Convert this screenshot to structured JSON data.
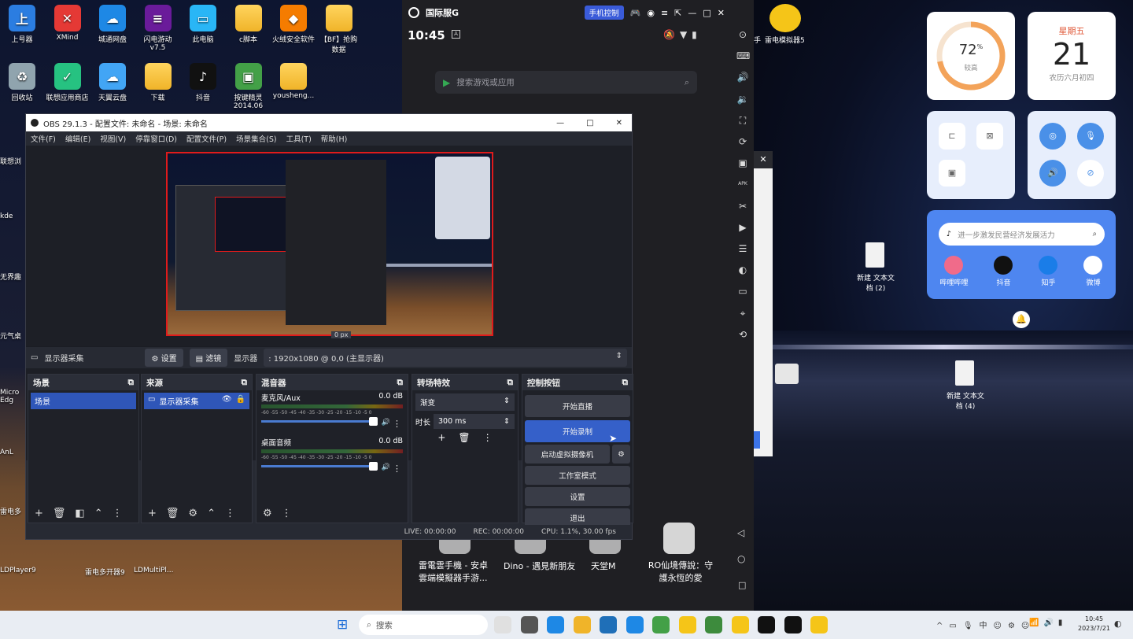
{
  "desktop_left_icons": [
    {
      "label": "上号器",
      "color": "#2b7de1",
      "glyph": "上"
    },
    {
      "label": "XMind",
      "color": "#e53935",
      "glyph": "✕"
    },
    {
      "label": "城通网盘",
      "color": "#1e88e5",
      "glyph": "☁"
    },
    {
      "label": "闪电游动\nv7.5",
      "color": "#6a1b9a",
      "glyph": "≡"
    },
    {
      "label": "此电脑",
      "color": "#29b6f6",
      "glyph": "▭"
    },
    {
      "label": "c脚本",
      "color": "folder",
      "glyph": ""
    },
    {
      "label": "火绒安全软件",
      "color": "#f57c00",
      "glyph": "◆"
    },
    {
      "label": "【BF】抢购\n数据",
      "color": "folder",
      "glyph": ""
    }
  ],
  "desktop_left_icons_row2": [
    {
      "label": "回收站",
      "color": "#90a4ae",
      "glyph": "♻"
    },
    {
      "label": "联想应用商店",
      "color": "#26c281",
      "glyph": "✓"
    },
    {
      "label": "天翼云盘",
      "color": "#42a5f5",
      "glyph": "☁"
    },
    {
      "label": "下载",
      "color": "folder",
      "glyph": ""
    },
    {
      "label": "抖音",
      "color": "#111",
      "glyph": "♪"
    },
    {
      "label": "按键精灵\n2014.06",
      "color": "#43a047",
      "glyph": "▣"
    },
    {
      "label": "yousheng...",
      "color": "folder",
      "glyph": ""
    }
  ],
  "desktop_side_labels": [
    "联想浏",
    "kde",
    "无界趣",
    "元气桌",
    "Micro\nEdg",
    "AnL",
    "雷电多",
    "LDPlayer9",
    "雷电多开器9",
    "LDMultiPl..."
  ],
  "android": {
    "brand": "国际服G",
    "control_badge": "手机控制",
    "time": "10:45",
    "search_placeholder": "搜索游戏或应用",
    "apps": [
      {
        "label": "雷電雲手機 - 安卓\n雲端模擬器手游..."
      },
      {
        "label": "Dino - 遇見新朋友"
      },
      {
        "label": "天堂M"
      },
      {
        "label": "RO仙境傳說：守\n護永恆的愛"
      }
    ]
  },
  "obs": {
    "title": "OBS 29.1.3 - 配置文件: 未命名 - 场景: 未命名",
    "menu": [
      "文件(F)",
      "编辑(E)",
      "视图(V)",
      "停靠窗口(D)",
      "配置文件(P)",
      "场景集合(S)",
      "工具(T)",
      "帮助(H)"
    ],
    "px_label": "0 px",
    "source_name": "显示器采集",
    "settings_btn": "设置",
    "filter_btn": "滤镜",
    "display_label": "显示器",
    "display_value": ": 1920x1080 @ 0,0 (主显示器)",
    "docks": {
      "scenes": {
        "title": "场景",
        "items": [
          "场景"
        ]
      },
      "sources": {
        "title": "来源",
        "items": [
          "显示器采集"
        ]
      },
      "mixer": {
        "title": "混音器",
        "tracks": [
          {
            "name": "麦克风/Aux",
            "db": "0.0 dB"
          },
          {
            "name": "桌面音频",
            "db": "0.0 dB"
          }
        ],
        "scale": "-60 -55 -50 -45 -40 -35 -30 -25 -20 -15 -10 -5 0"
      },
      "transitions": {
        "title": "转场特效",
        "type": "渐变",
        "duration_label": "时长",
        "duration": "300 ms"
      },
      "controls": {
        "title": "控制按钮",
        "buttons": [
          "开始直播",
          "开始录制",
          "启动虚拟摄像机",
          "工作室模式",
          "设置",
          "退出"
        ]
      }
    },
    "status": {
      "live": "LIVE: 00:00:00",
      "rec": "REC: 00:00:00",
      "cpu": "CPU: 1.1%, 30.00 fps"
    }
  },
  "widgets": {
    "battery_pct": "72",
    "battery_unit": "%",
    "battery_label": "较高",
    "weekday": "星期五",
    "day": "21",
    "lunar": "农历六月初四",
    "search_placeholder": "进一步激发民营经济发展活力",
    "shortcuts": [
      "哔哩哔哩",
      "抖音",
      "知乎",
      "微博"
    ]
  },
  "desktop_right": {
    "file1": "新建 文本文\n档 (2)",
    "file2": "新建 文本文\n档 (4)",
    "ld_label": "雷电模拟器5",
    "ld_prefix": "手"
  },
  "taskbar": {
    "search": "搜索",
    "time": "10:45",
    "date": "2023/7/21"
  }
}
